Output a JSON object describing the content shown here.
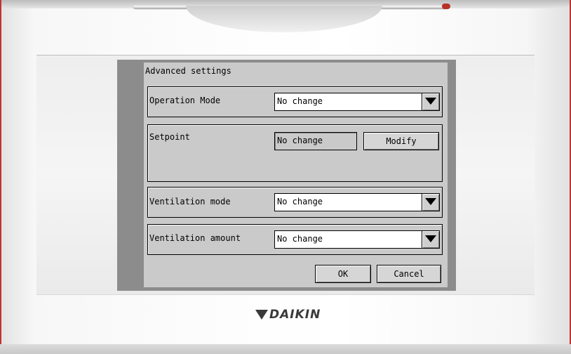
{
  "screen": {
    "title": "Advanced settings"
  },
  "operation_mode": {
    "label": "Operation Mode",
    "value": "No change"
  },
  "setpoint": {
    "label": "Setpoint",
    "value": "No change",
    "modify_label": "Modify"
  },
  "ventilation_mode": {
    "label": "Ventilation mode",
    "value": "No change"
  },
  "ventilation_amount": {
    "label": "Ventilation amount",
    "value": "No change"
  },
  "footer": {
    "ok_label": "OK",
    "cancel_label": "Cancel"
  },
  "brand": {
    "name": "DAIKIN",
    "logo_color": "#3a3a3a"
  },
  "icons": {
    "dropdown": "triangle-down-icon",
    "logo": "daikin-logo-icon"
  }
}
